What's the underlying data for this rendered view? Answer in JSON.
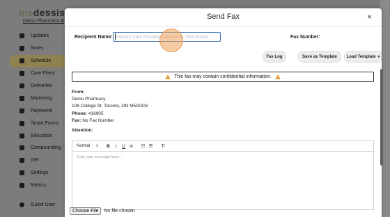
{
  "app": {
    "logo_text": "medessist",
    "pharmacy_link": "Demo Pharmacy"
  },
  "sidebar": {
    "items": [
      {
        "label": "Updates",
        "icon": "updates-icon"
      },
      {
        "label": "Notes",
        "icon": "notes-icon"
      },
      {
        "label": "Schedule",
        "icon": "calendar-icon",
        "active": true
      },
      {
        "label": "Care Plans",
        "icon": "people-icon"
      },
      {
        "label": "Deliveries",
        "icon": "truck-icon"
      },
      {
        "label": "Marketing",
        "icon": "megaphone-icon"
      },
      {
        "label": "Payments",
        "icon": "credit-card-icon"
      },
      {
        "label": "Smart Forms",
        "icon": "form-icon"
      },
      {
        "label": "Education",
        "icon": "graduation-cap-icon"
      },
      {
        "label": "Compounding",
        "icon": "mortar-icon"
      },
      {
        "label": "IVR",
        "icon": "phone-icon"
      },
      {
        "label": "Settings",
        "icon": "gear-icon"
      },
      {
        "label": "Metrics",
        "icon": "chart-icon"
      }
    ],
    "user_label": "Guest User"
  },
  "modal": {
    "title": "Send Fax",
    "close_symbol": "×",
    "recipient_label": "Recipient Name:",
    "recipient_placeholder": "Primary Care Provider Last Name, First Name",
    "recipient_value": "",
    "fax_number_label": "Fax Number:",
    "fax_log_label": "Fax Log",
    "save_template_label": "Save as Template",
    "load_template_label": "Load Template",
    "warning_text": "This fax may contain confidential information.",
    "from_label": "From:",
    "from_name": "Demo Pharmacy",
    "from_address": "108 College St, Toronto, ON M5G0C6",
    "phone_label": "Phone:",
    "phone_value": "416905",
    "fax_label": "Fax:",
    "fax_value": "No Fax Number",
    "attention_label": "Attention:",
    "editor": {
      "format_select": "Normal",
      "placeholder": "Type your message here..."
    },
    "file": {
      "choose_label": "Choose File",
      "status": "No file chosen"
    }
  },
  "colors": {
    "active_nav": "#8e8350",
    "input_border": "#3a6fb0",
    "warning_icon": "#e6a23c",
    "click_marker": "#f0a05a"
  }
}
